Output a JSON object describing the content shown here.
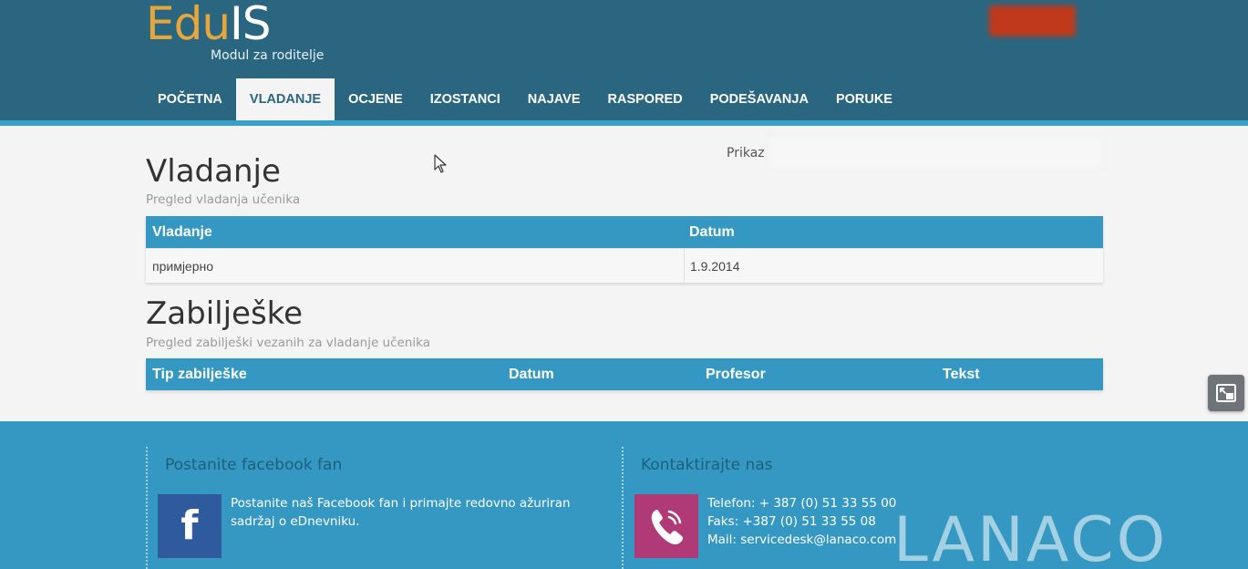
{
  "header": {
    "logo_part1": "Edu",
    "logo_part2": "IS",
    "logo_subtitle": "Modul za roditelje"
  },
  "nav": {
    "items": [
      {
        "label": "POČETNA"
      },
      {
        "label": "VLADANJE",
        "active": true
      },
      {
        "label": "OCJENE"
      },
      {
        "label": "IZOSTANCI"
      },
      {
        "label": "NAJAVE"
      },
      {
        "label": "RASPORED"
      },
      {
        "label": "PODEŠAVANJA"
      },
      {
        "label": "PORUKE"
      }
    ]
  },
  "prikaz": {
    "label": "Prikaz"
  },
  "vladanje": {
    "title": "Vladanje",
    "subtitle": "Pregled vladanja učenika",
    "columns": [
      "Vladanje",
      "Datum"
    ],
    "rows": [
      [
        "примјерно",
        "1.9.2014"
      ]
    ]
  },
  "zabiljeske": {
    "title": "Zabilješke",
    "subtitle": "Pregled zabilješki vezanih za vladanje učenika",
    "columns": [
      "Tip zabilješke",
      "Datum",
      "Profesor",
      "Tekst"
    ]
  },
  "footer": {
    "facebook": {
      "title": "Postanite facebook fan",
      "icon_letter": "f",
      "line1": "Postanite naš Facebook fan i primajte redovno ažuriran",
      "line2": "sadržaj o eDnevniku."
    },
    "contact": {
      "title": "Kontaktirajte nas",
      "phone": "Telefon: + 387 (0) 51 33 55 00",
      "fax": "Faks: +387 (0) 51 33 55 08",
      "mail": "Mail: servicedesk@lanaco.com"
    },
    "brand": "LANACO"
  },
  "colors": {
    "header_bg": "#2b6680",
    "accent": "#3498c2",
    "logo_orange": "#e7a63b",
    "facebook_blue": "#2f5a9e",
    "phone_magenta": "#b03a78"
  }
}
